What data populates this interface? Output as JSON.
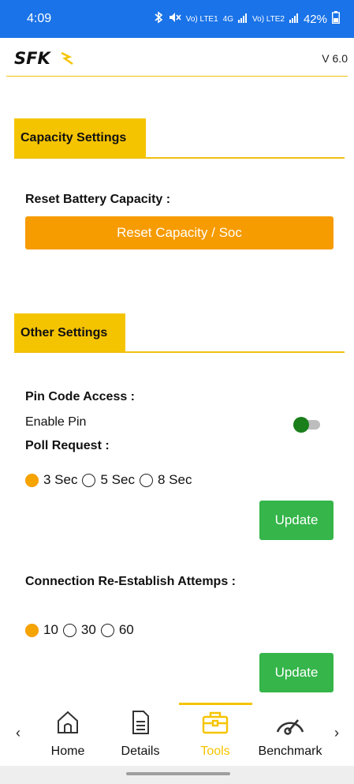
{
  "status_bar": {
    "time": "4:09",
    "signal_1": "Vo) LTE1",
    "network": "4G",
    "signal_2": "Vo) LTE2",
    "battery": "42%"
  },
  "app_bar": {
    "logo_text": "SFK",
    "version": "V 6.0"
  },
  "capacity_settings": {
    "title": "Capacity Settings",
    "reset_label": "Reset Battery Capacity :",
    "reset_button": "Reset Capacity / Soc"
  },
  "other_settings": {
    "title": "Other Settings",
    "pin_label": "Pin Code Access :",
    "enable_pin_label": "Enable Pin",
    "enable_pin": true,
    "poll_label": "Poll Request :",
    "poll_options": [
      "3 Sec",
      "5 Sec",
      "8 Sec"
    ],
    "poll_selected": "3 Sec",
    "poll_update_button": "Update",
    "reconnect_label": "Connection Re-Establish Attemps :",
    "reconnect_options": [
      "10",
      "30",
      "60"
    ],
    "reconnect_selected": "10",
    "reconnect_update_button": "Update"
  },
  "bottom_nav": {
    "items": [
      {
        "label": "Home",
        "icon": "home-icon"
      },
      {
        "label": "Details",
        "icon": "document-icon"
      },
      {
        "label": "Tools",
        "icon": "toolbox-icon"
      },
      {
        "label": "Benchmark",
        "icon": "speedometer-icon"
      }
    ],
    "active": "Tools",
    "prev_arrow": "‹",
    "next_arrow": "›"
  },
  "colors": {
    "status_bar": "#1a73e8",
    "accent_yellow": "#f5c400",
    "orange": "#f69b00",
    "green": "#35b54a",
    "toggle_on": "#1a7f1a"
  }
}
